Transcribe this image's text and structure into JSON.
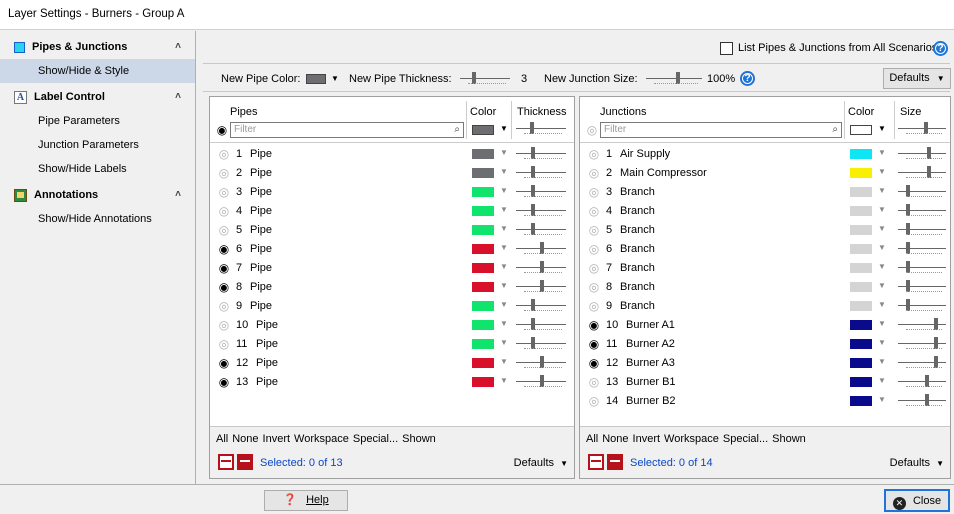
{
  "window": {
    "title": "Layer Settings - Burners - Group A"
  },
  "sidebar": {
    "sections": [
      {
        "label": "Pipes & Junctions",
        "items": [
          "Show/Hide & Style"
        ]
      },
      {
        "label": "Label Control",
        "items": [
          "Pipe Parameters",
          "Junction Parameters",
          "Show/Hide Labels"
        ]
      },
      {
        "label": "Annotations",
        "items": [
          "Show/Hide Annotations"
        ]
      }
    ]
  },
  "topbar": {
    "list_all_label": "List Pipes & Junctions from All Scenarios",
    "new_pipe_color_label": "New Pipe Color:",
    "new_pipe_color": "#6d6e71",
    "new_pipe_thickness_label": "New Pipe Thickness:",
    "new_pipe_thickness_value": "3",
    "new_junction_size_label": "New Junction Size:",
    "new_junction_size_value": "100%",
    "defaults_label": "Defaults"
  },
  "pipes_panel": {
    "col_name": "Pipes",
    "col_color": "Color",
    "col_thickness": "Thickness",
    "filter_placeholder": "Filter",
    "header_color": "#6d6e71",
    "rows": [
      {
        "num": "1",
        "name": "Pipe",
        "visible": false,
        "color": "#6d6e71",
        "level": 0.35
      },
      {
        "num": "2",
        "name": "Pipe",
        "visible": false,
        "color": "#6d6e71",
        "level": 0.35
      },
      {
        "num": "3",
        "name": "Pipe",
        "visible": false,
        "color": "#10e46c",
        "level": 0.35
      },
      {
        "num": "4",
        "name": "Pipe",
        "visible": false,
        "color": "#10e46c",
        "level": 0.35
      },
      {
        "num": "5",
        "name": "Pipe",
        "visible": false,
        "color": "#10e46c",
        "level": 0.35
      },
      {
        "num": "6",
        "name": "Pipe",
        "visible": true,
        "color": "#d9102c",
        "level": 0.55
      },
      {
        "num": "7",
        "name": "Pipe",
        "visible": true,
        "color": "#d9102c",
        "level": 0.55
      },
      {
        "num": "8",
        "name": "Pipe",
        "visible": true,
        "color": "#d9102c",
        "level": 0.55
      },
      {
        "num": "9",
        "name": "Pipe",
        "visible": false,
        "color": "#10e46c",
        "level": 0.35
      },
      {
        "num": "10",
        "name": "Pipe",
        "visible": false,
        "color": "#10e46c",
        "level": 0.35
      },
      {
        "num": "11",
        "name": "Pipe",
        "visible": false,
        "color": "#10e46c",
        "level": 0.35
      },
      {
        "num": "12",
        "name": "Pipe",
        "visible": true,
        "color": "#d9102c",
        "level": 0.55
      },
      {
        "num": "13",
        "name": "Pipe",
        "visible": true,
        "color": "#d9102c",
        "level": 0.55
      }
    ],
    "footer_links": [
      "All",
      "None",
      "Invert",
      "Workspace",
      "Special...",
      "Shown"
    ],
    "selected_text": "Selected: 0 of 13",
    "defaults_label": "Defaults"
  },
  "junctions_panel": {
    "col_name": "Junctions",
    "col_color": "Color",
    "col_size": "Size",
    "filter_placeholder": "Filter",
    "header_color": "#ffffff",
    "rows": [
      {
        "num": "1",
        "name": "Air Supply",
        "visible": false,
        "color": "#0fe6f5",
        "level": 0.7
      },
      {
        "num": "2",
        "name": "Main Compressor",
        "visible": false,
        "color": "#f9ef00",
        "level": 0.7
      },
      {
        "num": "3",
        "name": "Branch",
        "visible": false,
        "color": "#d4d4d4",
        "level": 0.2
      },
      {
        "num": "4",
        "name": "Branch",
        "visible": false,
        "color": "#d4d4d4",
        "level": 0.2
      },
      {
        "num": "5",
        "name": "Branch",
        "visible": false,
        "color": "#d4d4d4",
        "level": 0.2
      },
      {
        "num": "6",
        "name": "Branch",
        "visible": false,
        "color": "#d4d4d4",
        "level": 0.2
      },
      {
        "num": "7",
        "name": "Branch",
        "visible": false,
        "color": "#d4d4d4",
        "level": 0.2
      },
      {
        "num": "8",
        "name": "Branch",
        "visible": false,
        "color": "#d4d4d4",
        "level": 0.2
      },
      {
        "num": "9",
        "name": "Branch",
        "visible": false,
        "color": "#d4d4d4",
        "level": 0.2
      },
      {
        "num": "10",
        "name": "Burner A1",
        "visible": true,
        "color": "#0a0a8c",
        "level": 0.85
      },
      {
        "num": "11",
        "name": "Burner A2",
        "visible": true,
        "color": "#0a0a8c",
        "level": 0.85
      },
      {
        "num": "12",
        "name": "Burner A3",
        "visible": true,
        "color": "#0a0a8c",
        "level": 0.85
      },
      {
        "num": "13",
        "name": "Burner B1",
        "visible": false,
        "color": "#0a0a8c",
        "level": 0.65
      },
      {
        "num": "14",
        "name": "Burner B2",
        "visible": false,
        "color": "#0a0a8c",
        "level": 0.65
      }
    ],
    "footer_links": [
      "All",
      "None",
      "Invert",
      "Workspace",
      "Special...",
      "Shown"
    ],
    "selected_text": "Selected: 0 of 14",
    "defaults_label": "Defaults"
  },
  "bottombar": {
    "help_label": "Help",
    "close_label": "Close"
  }
}
